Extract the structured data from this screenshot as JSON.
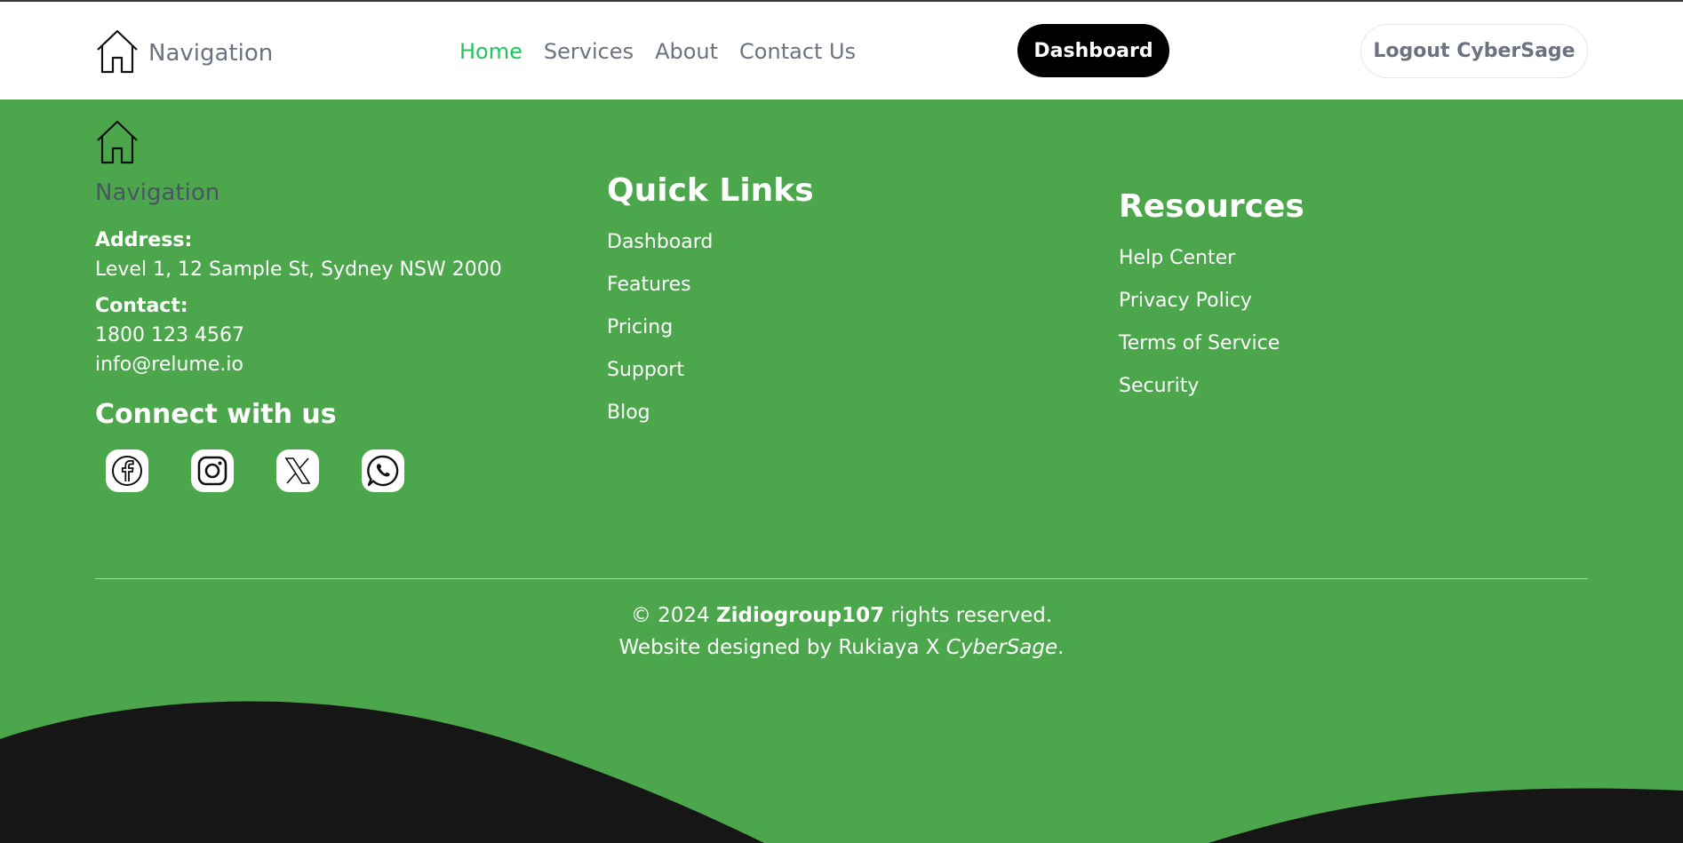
{
  "header": {
    "brand_label": "Navigation",
    "nav": [
      {
        "label": "Home",
        "active": true
      },
      {
        "label": "Services",
        "active": false
      },
      {
        "label": "About",
        "active": false
      },
      {
        "label": "Contact Us",
        "active": false
      }
    ],
    "dashboard_button": "Dashboard",
    "logout_button": "Logout CyberSage"
  },
  "footer": {
    "brand_label": "Navigation",
    "address_label": "Address:",
    "address_value": "Level 1, 12 Sample St, Sydney NSW 2000",
    "contact_label": "Contact:",
    "phone": "1800 123 4567",
    "email": "info@relume.io",
    "connect_heading": "Connect with us",
    "socials": [
      "facebook-icon",
      "instagram-icon",
      "x-icon",
      "whatsapp-icon"
    ],
    "quick_links": {
      "heading": "Quick Links",
      "items": [
        "Dashboard",
        "Features",
        "Pricing",
        "Support",
        "Blog"
      ]
    },
    "resources": {
      "heading": "Resources",
      "items": [
        "Help Center",
        "Privacy Policy",
        "Terms of Service",
        "Security"
      ]
    },
    "copyright_prefix": "© 2024",
    "copyright_brand": "Zidiogroup107",
    "copyright_suffix": "rights reserved.",
    "designed_by_prefix": "Website designed by Rukiaya X",
    "designed_by_name": "CyberSage",
    "designed_by_suffix": "."
  },
  "colors": {
    "footer_bg": "#4ca64c",
    "active_nav": "#22c55e",
    "wave": "#161616"
  }
}
